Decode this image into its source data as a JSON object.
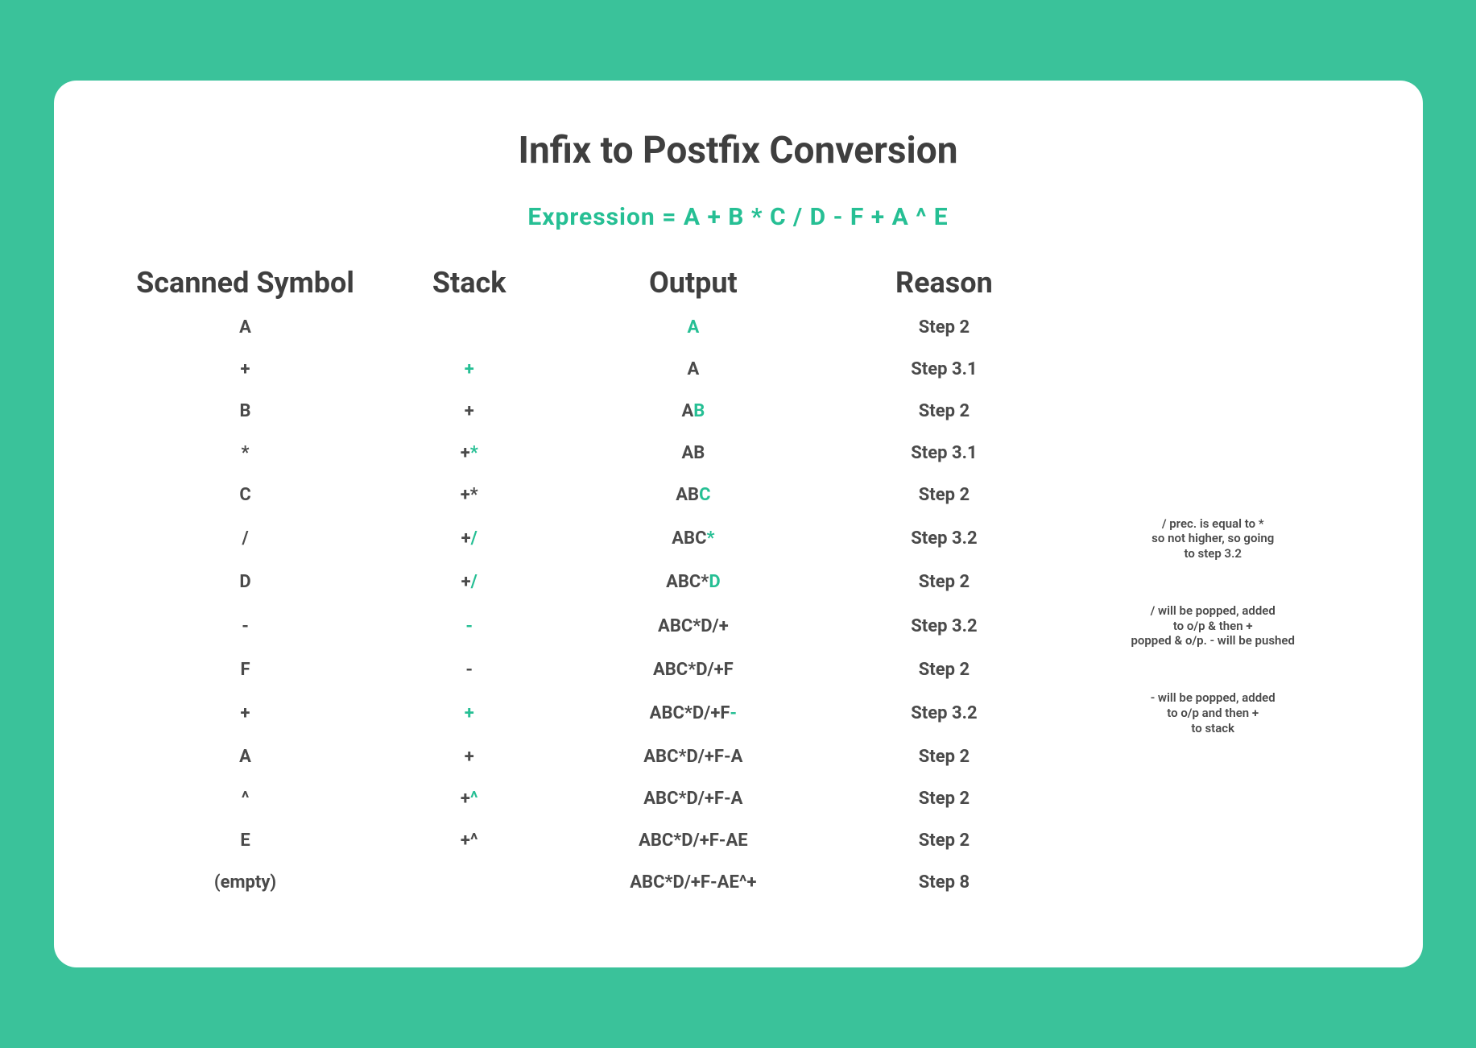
{
  "title": "Infix to Postfix Conversion",
  "expression": "Expression = A + B * C / D - F + A ^ E",
  "headers": {
    "scanned": "Scanned Symbol",
    "stack": "Stack",
    "output": "Output",
    "reason": "Reason",
    "note": ""
  },
  "rows": [
    {
      "scanned": "A",
      "stack_pre": "",
      "stack_hl": "",
      "out_pre": "",
      "out_hl": "A",
      "out_post": "",
      "reason": "Step 2",
      "note": ""
    },
    {
      "scanned": "+",
      "stack_pre": "",
      "stack_hl": "+",
      "out_pre": "A",
      "out_hl": "",
      "out_post": "",
      "reason": "Step 3.1",
      "note": ""
    },
    {
      "scanned": "B",
      "stack_pre": "+",
      "stack_hl": "",
      "out_pre": "A",
      "out_hl": "B",
      "out_post": "",
      "reason": "Step 2",
      "note": ""
    },
    {
      "scanned": "*",
      "stack_pre": "+",
      "stack_hl": "*",
      "out_pre": "AB",
      "out_hl": "",
      "out_post": "",
      "reason": "Step 3.1",
      "note": ""
    },
    {
      "scanned": "C",
      "stack_pre": "+*",
      "stack_hl": "",
      "out_pre": "AB",
      "out_hl": "C",
      "out_post": "",
      "reason": "Step 2",
      "note": ""
    },
    {
      "scanned": "/",
      "stack_pre": "+",
      "stack_hl": "/",
      "out_pre": "ABC",
      "out_hl": "*",
      "out_post": "",
      "reason": "Step 3.2",
      "note": "/ prec. is equal to *\nso not higher, so going\nto step 3.2"
    },
    {
      "scanned": "D",
      "stack_pre": "+",
      "stack_hl": "/",
      "out_pre": "ABC*",
      "out_hl": "D",
      "out_post": "",
      "reason": "Step 2",
      "note": ""
    },
    {
      "scanned": "-",
      "stack_pre": "",
      "stack_hl": "-",
      "out_pre": "ABC*D/+",
      "out_hl": "",
      "out_post": "",
      "reason": "Step 3.2",
      "note": "/ will be popped, added\nto o/p & then +\npopped & o/p. - will be pushed"
    },
    {
      "scanned": "F",
      "stack_pre": "-",
      "stack_hl": "",
      "out_pre": "ABC*D/+F",
      "out_hl": "",
      "out_post": "",
      "reason": "Step 2",
      "note": ""
    },
    {
      "scanned": "+",
      "stack_pre": "",
      "stack_hl": "+",
      "out_pre": "ABC*D/+F",
      "out_hl": "-",
      "out_post": "",
      "reason": "Step 3.2",
      "note": "- will be popped, added\nto o/p and then +\nto stack"
    },
    {
      "scanned": "A",
      "stack_pre": "+",
      "stack_hl": "",
      "out_pre": "ABC*D/+F-A",
      "out_hl": "",
      "out_post": "",
      "reason": "Step 2",
      "note": ""
    },
    {
      "scanned": "^",
      "stack_pre": "+",
      "stack_hl": "^",
      "out_pre": "ABC*D/+F-A",
      "out_hl": "",
      "out_post": "",
      "reason": "Step 2",
      "note": ""
    },
    {
      "scanned": "E",
      "stack_pre": "+^",
      "stack_hl": "",
      "out_pre": "ABC*D/+F-AE",
      "out_hl": "",
      "out_post": "",
      "reason": "Step 2",
      "note": ""
    },
    {
      "scanned": "(empty)",
      "stack_pre": "",
      "stack_hl": "",
      "out_pre": "ABC*D/+F-AE^+",
      "out_hl": "",
      "out_post": "",
      "reason": "Step 8",
      "note": ""
    }
  ]
}
